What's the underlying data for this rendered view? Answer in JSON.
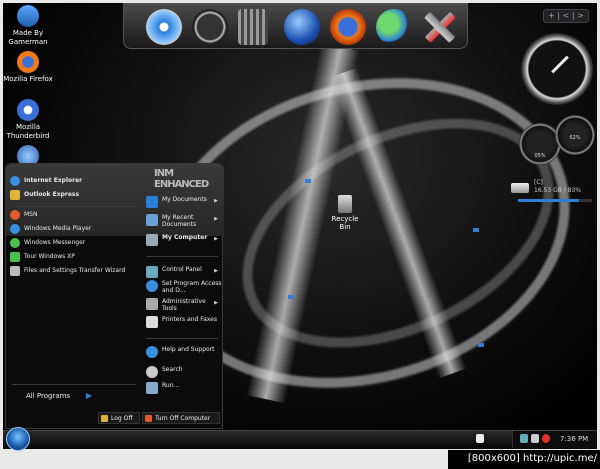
{
  "desktop_icons": [
    {
      "label": "Made By Gamerman",
      "icon": "user-icon"
    },
    {
      "label": "Mozilla Firefox",
      "icon": "firefox-icon"
    },
    {
      "label": "Mozilla Thunderbird",
      "icon": "thunderbird-icon"
    }
  ],
  "recycle_bin": {
    "label": "Recycle Bin"
  },
  "widget_bar": {
    "label": "+ | < | >"
  },
  "drive": {
    "label": "[C]",
    "info": "16.53 GB / 83%",
    "used_fraction": 0.83
  },
  "gauges": {
    "left_value": "05%",
    "right_value": "62%"
  },
  "start_menu": {
    "logo": "INM ENHANCED",
    "pinned": [
      {
        "label": "Internet Explorer",
        "icon": "ie-icon",
        "color": "#3b8fe0"
      },
      {
        "label": "Outlook Express",
        "icon": "outlook-icon",
        "color": "#e0b13b"
      }
    ],
    "recent": [
      {
        "label": "MSN",
        "icon": "msn-icon",
        "color": "#e05a2a"
      },
      {
        "label": "Windows Media Player",
        "icon": "wmp-icon",
        "color": "#3b8fe0"
      },
      {
        "label": "Windows Messenger",
        "icon": "messenger-icon",
        "color": "#4cbf4c"
      },
      {
        "label": "Tour Windows XP",
        "icon": "tour-icon",
        "color": "#4cbf4c"
      },
      {
        "label": "Files and Settings Transfer Wizard",
        "icon": "transfer-icon",
        "color": "#bbbbbb"
      }
    ],
    "all_programs": "All Programs",
    "right": [
      {
        "label": "My Documents",
        "icon": "folder-icon",
        "arrow": true
      },
      {
        "label": "My Recent Documents",
        "icon": "recent-docs-icon",
        "arrow": true
      },
      {
        "label": "My Computer",
        "icon": "computer-icon",
        "arrow": true
      },
      {
        "label": "Control Panel",
        "icon": "control-panel-icon",
        "arrow": true
      },
      {
        "label": "Set Program Access and D...",
        "icon": "program-access-icon",
        "arrow": false
      },
      {
        "label": "Administrative Tools",
        "icon": "admin-tools-icon",
        "arrow": true
      },
      {
        "label": "Printers and Faxes",
        "icon": "printer-icon",
        "arrow": false
      },
      {
        "label": "Help and Support",
        "icon": "help-icon",
        "arrow": false
      },
      {
        "label": "Search",
        "icon": "search-icon",
        "arrow": false
      },
      {
        "label": "Run...",
        "icon": "run-icon",
        "arrow": false
      }
    ],
    "log_off": "Log Off",
    "turn_off": "Turn Off Computer"
  },
  "dock": [
    "safari-icon",
    "clock-icon",
    "trash-icon",
    "globe-icon",
    "firefox-icon",
    "messenger-icon",
    "tools-icon"
  ],
  "taskbar": {
    "clock": "7:36 PM"
  },
  "watermark": "[800x600] http://upic.me/"
}
